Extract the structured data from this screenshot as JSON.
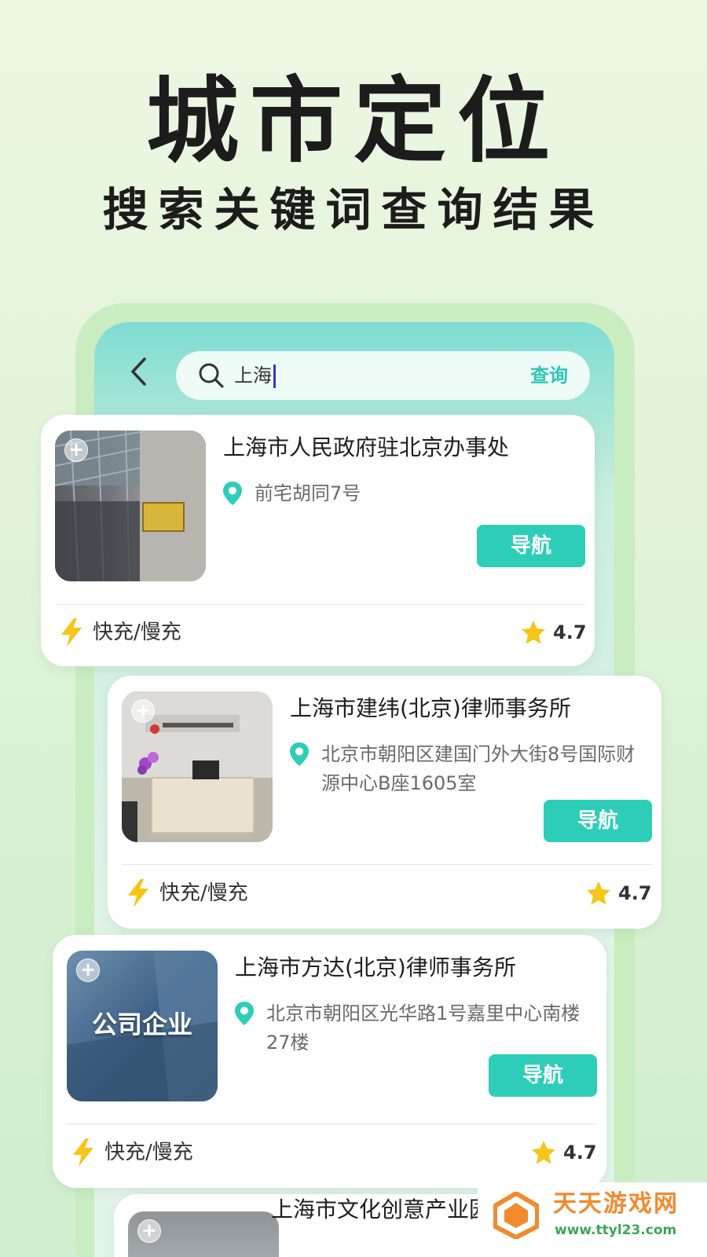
{
  "hero": {
    "title": "城市定位",
    "subtitle": "搜索关键词查询结果"
  },
  "search": {
    "query": "上海",
    "submit_label": "查询"
  },
  "results": [
    {
      "title": "上海市人民政府驻北京办事处",
      "address": "前宅胡同7号",
      "nav_label": "导航",
      "charge": "快充/慢充",
      "rating": "4.7"
    },
    {
      "title": "上海市建纬(北京)律师事务所",
      "address": "北京市朝阳区建国门外大街8号国际财源中心B座1605室",
      "nav_label": "导航",
      "charge": "快充/慢充",
      "rating": "4.7"
    },
    {
      "title": "上海市方达(北京)律师事务所",
      "address": "北京市朝阳区光华路1号嘉里中心南楼27楼",
      "nav_label": "导航",
      "charge": "快充/慢充",
      "rating": "4.7",
      "thumb_label": "公司企业"
    },
    {
      "title": "上海市文化创意产业园区"
    }
  ],
  "watermark": {
    "name": "天天游戏网",
    "url": "www.ttyl23.com"
  },
  "colors": {
    "accent": "#2ecdb8",
    "star": "#f5c518",
    "bolt": "#f5c518"
  }
}
